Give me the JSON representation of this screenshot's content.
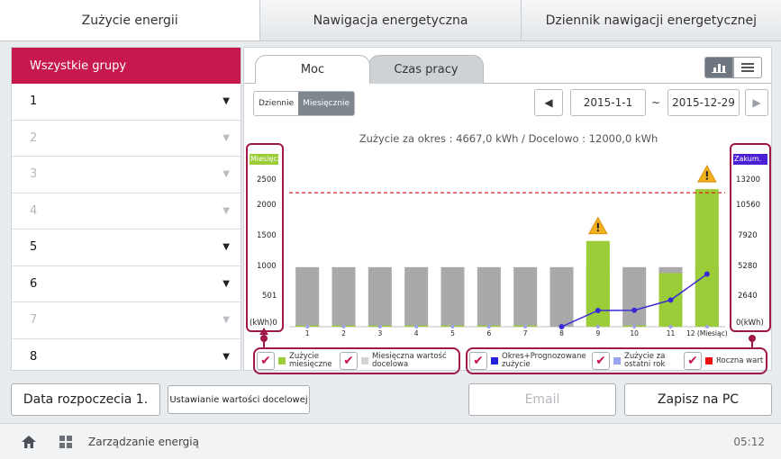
{
  "tabs": [
    {
      "label": "Zużycie energii"
    },
    {
      "label": "Nawigacja energetyczna"
    },
    {
      "label": "Dziennik nawigacji energetycznej"
    }
  ],
  "sidebar": {
    "header": "Wszystkie grupy",
    "items": [
      {
        "label": "1",
        "enabled": true
      },
      {
        "label": "2",
        "enabled": false
      },
      {
        "label": "3",
        "enabled": false
      },
      {
        "label": "4",
        "enabled": false
      },
      {
        "label": "5",
        "enabled": true
      },
      {
        "label": "6",
        "enabled": true
      },
      {
        "label": "7",
        "enabled": false
      },
      {
        "label": "8",
        "enabled": true
      }
    ]
  },
  "subtabs": {
    "power": "Moc",
    "runtime": "Czas pracy"
  },
  "view_icons": {
    "chart": "bar-chart-icon",
    "list": "list-icon"
  },
  "period": {
    "daily": "Dziennie",
    "monthly": "Miesięcznie"
  },
  "date_range": {
    "from": "2015-1-1",
    "sep": "~",
    "to": "2015-12-29"
  },
  "summary": "Zużycie za okres : 4667,0 kWh / Docelowo : 12000,0 kWh",
  "chart_data": {
    "type": "bar",
    "left_axis_tag": "Miesięczne",
    "right_axis_tag": "Zakum.",
    "left_ticks": [
      "2500",
      "2000",
      "1500",
      "1000",
      "501",
      "(kWh)0"
    ],
    "right_ticks": [
      "13200",
      "10560",
      "7920",
      "5280",
      "2640",
      "0(kWh)"
    ],
    "categories": [
      "1",
      "2",
      "3",
      "4",
      "5",
      "6",
      "7",
      "8",
      "9",
      "10",
      "11",
      "12 (Miesiąc)"
    ],
    "ylim": [
      0,
      2750
    ],
    "y2lim": [
      0,
      14520
    ],
    "series": [
      {
        "name": "Zużycie miesięczne",
        "values": [
          20,
          20,
          20,
          20,
          20,
          20,
          20,
          0,
          1440,
          20,
          900,
          2310
        ]
      },
      {
        "name": "Miesięczna wartość docelowa",
        "values": [
          1000,
          1000,
          1000,
          1000,
          1000,
          1000,
          1000,
          1000,
          1000,
          1000,
          1000,
          1000
        ]
      },
      {
        "name": "Okres+Prognozowane zużycie",
        "values": [
          null,
          null,
          null,
          null,
          null,
          null,
          null,
          0,
          1440,
          1460,
          2360,
          4667
        ]
      }
    ],
    "annual_target_line": 2250,
    "warning_months": [
      9,
      12
    ],
    "colors": {
      "usage": "#9acd38",
      "target": "#a9a9a9",
      "cumulative": "#3b2bd6",
      "target_line": "#e02020",
      "annual": "#e02020",
      "last_year": "#9aa3f0"
    }
  },
  "legend": [
    {
      "label": "Zużycie miesięczne",
      "color": "#9acd38"
    },
    {
      "label": "Miesięczna wartość docelowa",
      "color": "#d4d4d4"
    },
    {
      "label": "Okres+Prognozowane zużycie",
      "color": "#2222dd"
    },
    {
      "label": "Zużycie za ostatni rok",
      "color": "#9aa3f0"
    },
    {
      "label": "Roczna wartość docelowa",
      "color": "#ee1111"
    }
  ],
  "bottom": {
    "start_date": "Data rozpoczecia 1.",
    "target_set": "Ustawianie wartości docelowej",
    "email": "Email",
    "save_pc": "Zapisz na PC"
  },
  "status": {
    "title": "Zarządzanie energią",
    "time": "05:12"
  }
}
